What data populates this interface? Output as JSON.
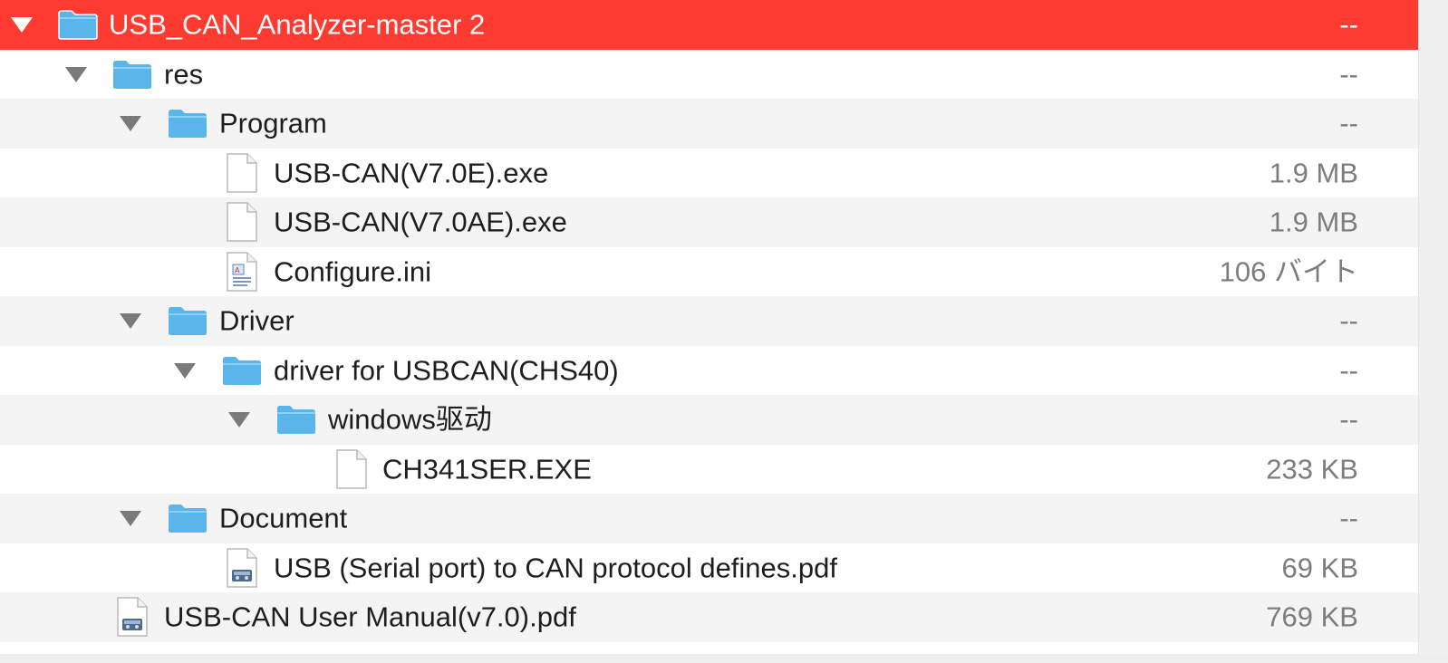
{
  "file_list": {
    "rows": [
      {
        "name": "USB_CAN_Analyzer-master 2",
        "size": "--",
        "kind": "folder",
        "expanded": true,
        "selected": true
      },
      {
        "name": "res",
        "size": "--",
        "kind": "folder",
        "expanded": true
      },
      {
        "name": "Program",
        "size": "--",
        "kind": "folder",
        "expanded": true
      },
      {
        "name": "USB-CAN(V7.0E).exe",
        "size": "1.9 MB",
        "kind": "blank-file"
      },
      {
        "name": "USB-CAN(V7.0AE).exe",
        "size": "1.9 MB",
        "kind": "blank-file"
      },
      {
        "name": "Configure.ini",
        "size": "106 バイト",
        "kind": "text-file"
      },
      {
        "name": "Driver",
        "size": "--",
        "kind": "folder",
        "expanded": true
      },
      {
        "name": "driver for USBCAN(CHS40)",
        "size": "--",
        "kind": "folder",
        "expanded": true
      },
      {
        "name": "windows驱动",
        "size": "--",
        "kind": "folder",
        "expanded": true
      },
      {
        "name": "CH341SER.EXE",
        "size": "233 KB",
        "kind": "blank-file"
      },
      {
        "name": "Document",
        "size": "--",
        "kind": "folder",
        "expanded": true
      },
      {
        "name": "USB (Serial port) to CAN protocol defines.pdf",
        "size": "69 KB",
        "kind": "pdf-file"
      },
      {
        "name": "USB-CAN User Manual(v7.0).pdf",
        "size": "769 KB",
        "kind": "pdf-file"
      }
    ]
  },
  "colors": {
    "selection": "#fe3b30",
    "folder": "#5ab5ea",
    "row_alt": "#f4f4f4",
    "size_text": "#7d7d7d"
  },
  "icons": {
    "disclosure": "disclosure-triangle-icon",
    "folder": "folder-icon",
    "blank_file": "document-icon",
    "text_file": "text-document-icon",
    "pdf_file": "pdf-document-icon"
  }
}
